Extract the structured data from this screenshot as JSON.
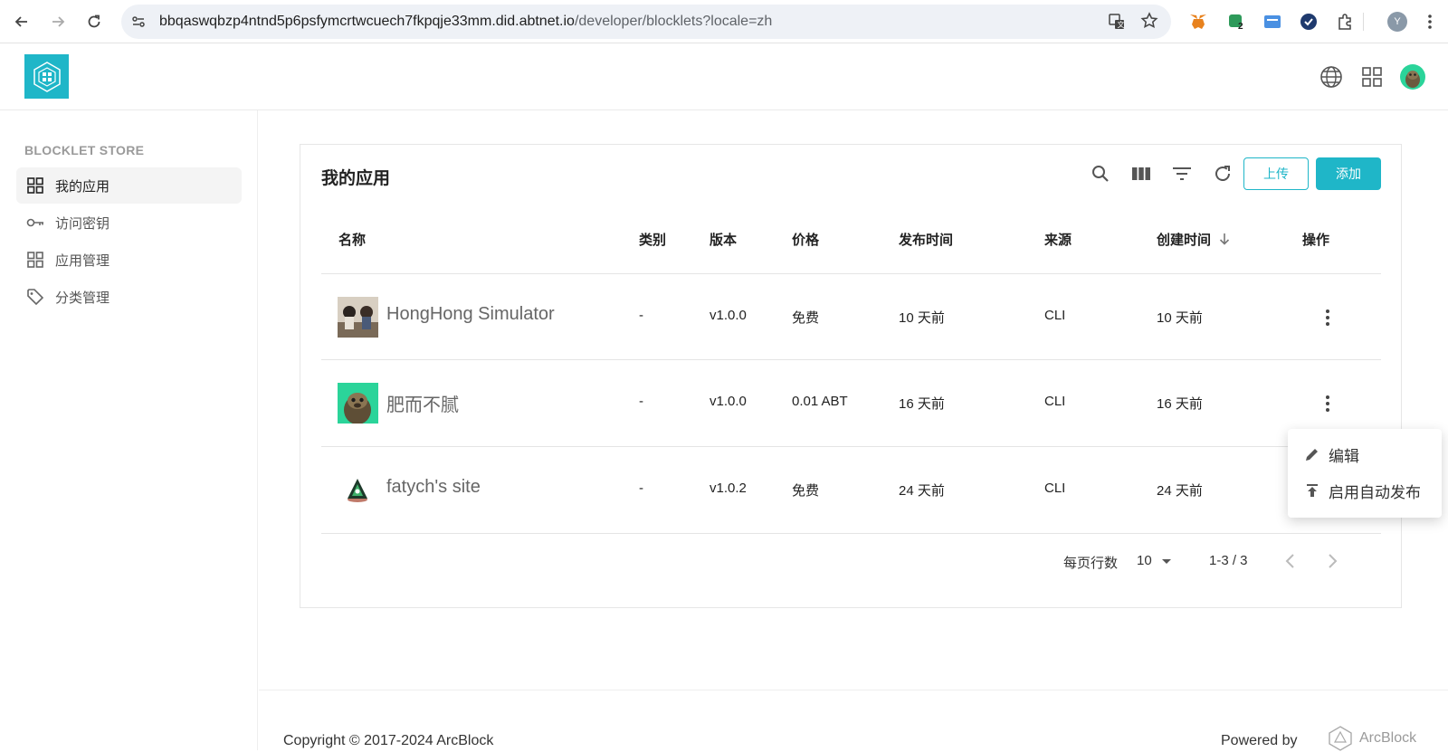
{
  "browser": {
    "url_host": "bbqaswqbzp4ntnd5p6psfymcrtwcuech7fkpqje33mm.did.abtnet.io",
    "url_path": "/developer/blocklets?locale=zh",
    "profile_initial": "Y",
    "extension_badge": "2"
  },
  "sidebar": {
    "title": "BLOCKLET STORE",
    "items": [
      {
        "label": "我的应用",
        "icon": "grid-icon",
        "active": true
      },
      {
        "label": "访问密钥",
        "icon": "key-icon",
        "active": false
      },
      {
        "label": "应用管理",
        "icon": "grid-icon",
        "active": false
      },
      {
        "label": "分类管理",
        "icon": "tag-icon",
        "active": false
      }
    ]
  },
  "main": {
    "title": "我的应用",
    "upload_label": "上传",
    "add_label": "添加",
    "columns": [
      "名称",
      "类别",
      "版本",
      "价格",
      "发布时间",
      "来源",
      "创建时间",
      "操作"
    ],
    "rows": [
      {
        "name": "HongHong Simulator",
        "category": "-",
        "version": "v1.0.0",
        "price": "免费",
        "published": "10 天前",
        "source": "CLI",
        "created": "10 天前"
      },
      {
        "name": "肥而不腻",
        "category": "-",
        "version": "v1.0.0",
        "price": "0.01 ABT",
        "published": "16 天前",
        "source": "CLI",
        "created": "16 天前"
      },
      {
        "name": "fatych's site",
        "category": "-",
        "version": "v1.0.2",
        "price": "免费",
        "published": "24 天前",
        "source": "CLI",
        "created": "24 天前"
      }
    ],
    "pager": {
      "rows_per_page_label": "每页行数",
      "rows_per_page": "10",
      "range": "1-3 / 3"
    }
  },
  "menu": {
    "items": [
      {
        "label": "编辑",
        "icon": "pencil-icon"
      },
      {
        "label": "启用自动发布",
        "icon": "publish-icon"
      }
    ]
  },
  "footer": {
    "copyright": "Copyright © 2017-2024  ArcBlock",
    "powered_by": "Powered by",
    "brand": "ArcBlock"
  },
  "colors": {
    "accent": "#1fb6c8"
  }
}
